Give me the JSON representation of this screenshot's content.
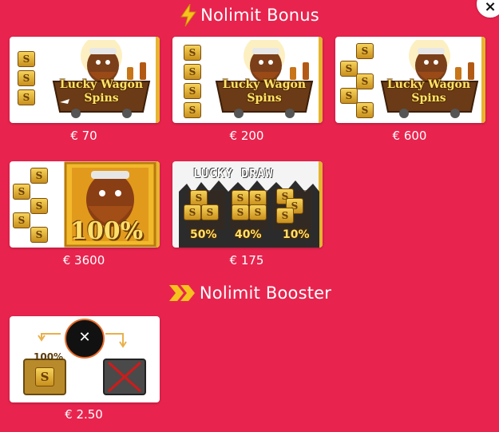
{
  "sections": {
    "bonus": {
      "title": "Nolimit Bonus",
      "icon": "lightning-icon"
    },
    "booster": {
      "title": "Nolimit Booster",
      "icon": "double-chevron-icon"
    }
  },
  "close": {
    "icon": "close-icon",
    "label": "×"
  },
  "bonus_items": [
    {
      "art_text": "Lucky Wagon Spins",
      "price": "€ 70"
    },
    {
      "art_text": "Lucky Wagon Spins",
      "price": "€ 200"
    },
    {
      "art_text": "Lucky Wagon Spins",
      "price": "€ 600"
    },
    {
      "art_text": "100%",
      "price": "€ 3600"
    },
    {
      "art_text": "LUCKY DRAW",
      "percentages": [
        "50%",
        "40%",
        "10%"
      ],
      "price": "€ 175"
    }
  ],
  "booster_items": [
    {
      "badge": "100%",
      "price": "€ 2.50"
    }
  ],
  "colors": {
    "background": "#e8244e",
    "card": "#ffffff",
    "gold": "#e7b430"
  },
  "coin_letter": "S"
}
